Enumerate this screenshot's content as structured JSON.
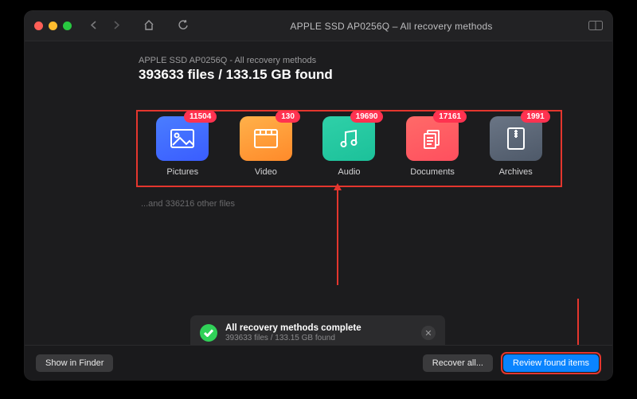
{
  "window": {
    "title": "APPLE SSD AP0256Q – All recovery methods"
  },
  "header": {
    "subtitle": "APPLE SSD AP0256Q - All recovery methods",
    "summary": "393633 files / 133.15 GB found"
  },
  "categories": [
    {
      "name": "pictures",
      "label": "Pictures",
      "count": "11504",
      "color": "blue"
    },
    {
      "name": "video",
      "label": "Video",
      "count": "130",
      "color": "orange"
    },
    {
      "name": "audio",
      "label": "Audio",
      "count": "19690",
      "color": "teal"
    },
    {
      "name": "documents",
      "label": "Documents",
      "count": "17161",
      "color": "coral"
    },
    {
      "name": "archives",
      "label": "Archives",
      "count": "1991",
      "color": "slate"
    }
  ],
  "other_files_text": "...and 336216 other files",
  "status": {
    "title": "All recovery methods complete",
    "detail": "393633 files / 133.15 GB found"
  },
  "footer": {
    "show_in_finder": "Show in Finder",
    "recover_all": "Recover all...",
    "review": "Review found items"
  }
}
